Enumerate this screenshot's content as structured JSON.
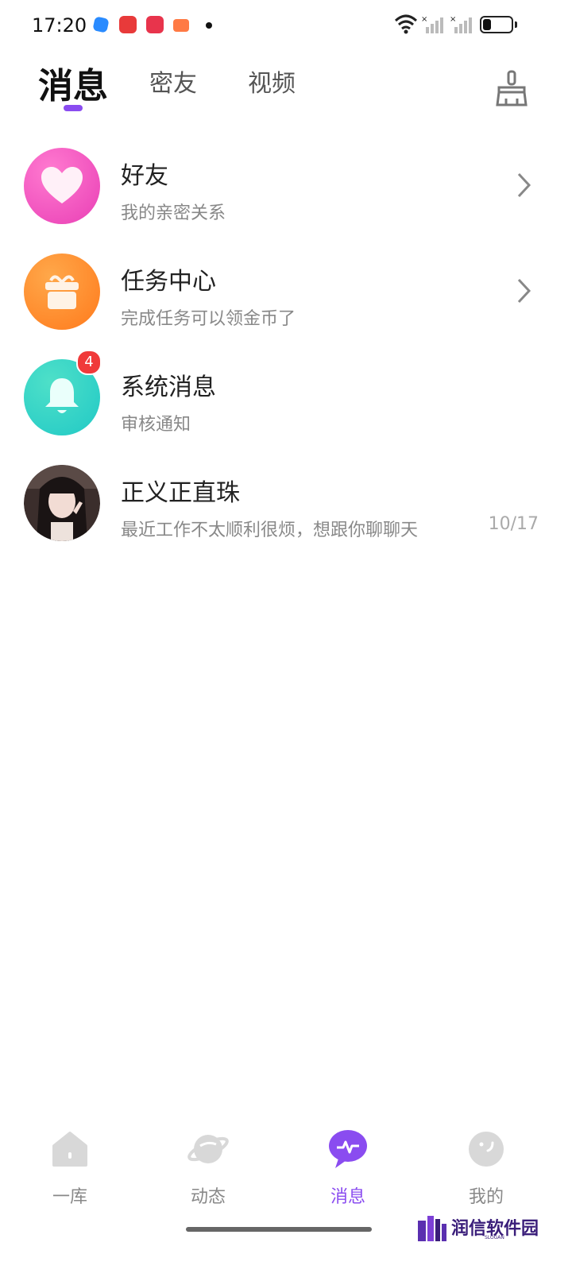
{
  "status_bar": {
    "time": "17:20",
    "battery_level": 0.3
  },
  "header": {
    "tabs": [
      {
        "label": "消息"
      },
      {
        "label": "密友"
      },
      {
        "label": "视频"
      }
    ],
    "active_tab": 0,
    "clean_icon": "broom-icon"
  },
  "list": [
    {
      "title": "好友",
      "subtitle": "我的亲密关系",
      "icon": "heart-icon",
      "color": "#ee55c0"
    },
    {
      "title": "任务中心",
      "subtitle": "完成任务可以领金币了",
      "icon": "gift-icon",
      "color": "#ff8a24"
    },
    {
      "title": "系统消息",
      "subtitle": "审核通知",
      "icon": "bell-icon",
      "color": "#2fd3c4",
      "badge": "4"
    },
    {
      "title": "正义正直珠",
      "subtitle": "最近工作不太顺利很烦，想跟你聊聊天",
      "time": "10/17",
      "icon": "user-avatar"
    }
  ],
  "bottom_nav": [
    {
      "label": "一库",
      "icon": "home-icon"
    },
    {
      "label": "动态",
      "icon": "planet-icon"
    },
    {
      "label": "消息",
      "icon": "message-icon"
    },
    {
      "label": "我的",
      "icon": "profile-icon"
    }
  ],
  "active_nav": 2,
  "colors": {
    "accent": "#8a4cf0",
    "badge": "#f03a3a"
  },
  "watermark": {
    "text": "润信软件园",
    "sub": "SLOGAN"
  }
}
